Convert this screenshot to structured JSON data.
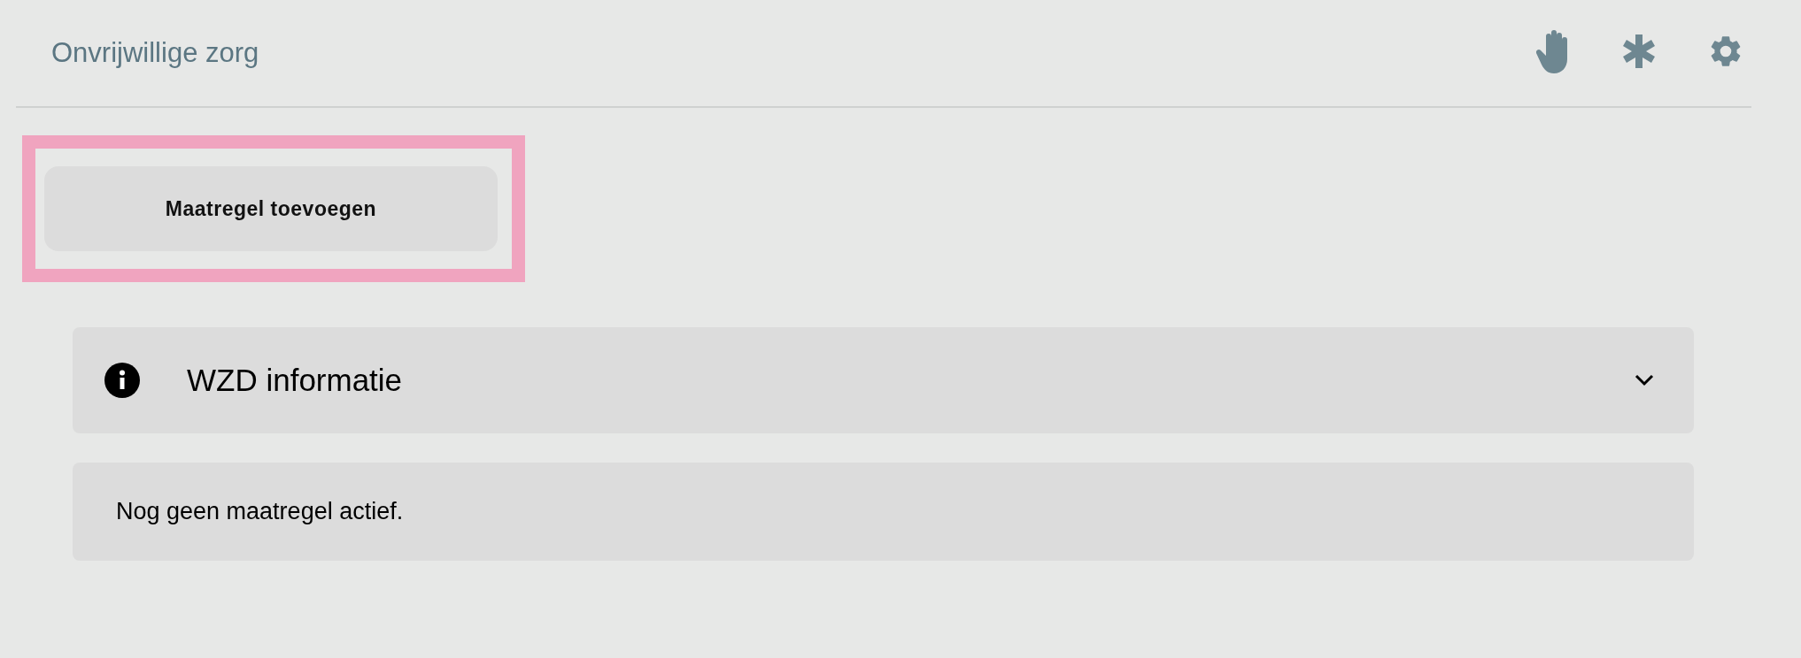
{
  "header": {
    "title": "Onvrijwillige zorg"
  },
  "add_button": {
    "label": "Maatregel toevoegen",
    "highlighted": true
  },
  "info_panel": {
    "title": "WZD informatie",
    "expanded": false
  },
  "status_message": "Nog geen maatregel actief."
}
